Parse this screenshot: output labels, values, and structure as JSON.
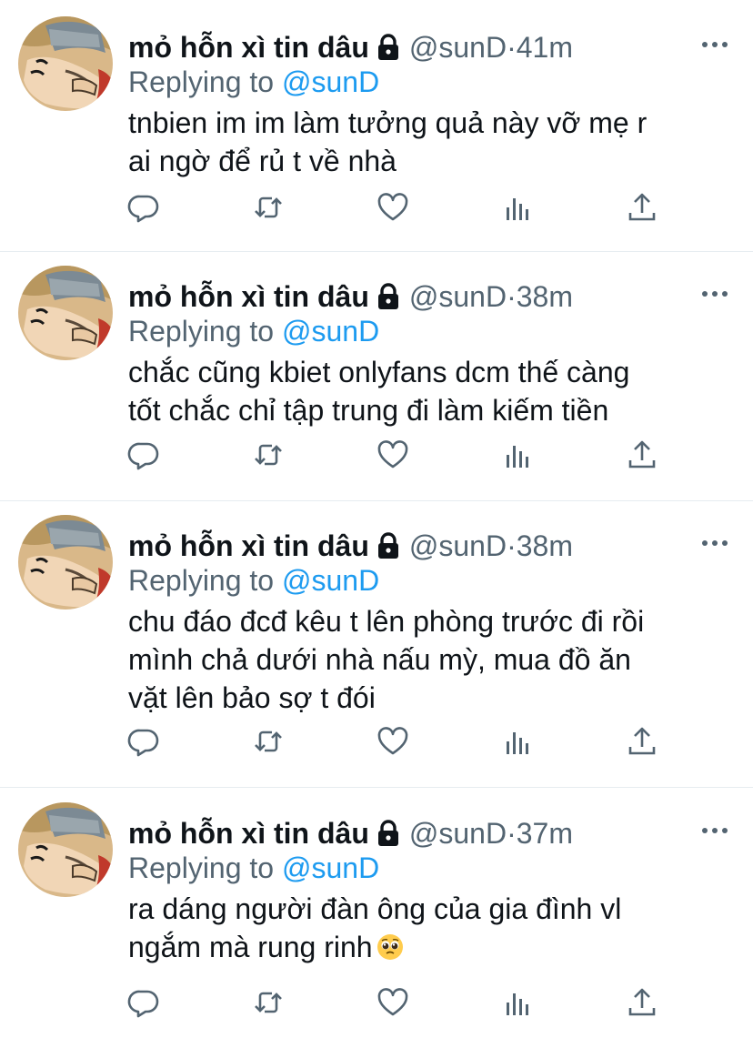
{
  "tweets": [
    {
      "name": "mỏ hỗn xì tin dâu",
      "handle": "@sunD",
      "separator": " · ",
      "time": "41m",
      "replying_label": "Replying to ",
      "replying_to": "@sunD",
      "text_lines": [
        "tnbien im im làm tưởng quả này vỡ mẹ r",
        "ai ngờ để rủ t về nhà"
      ]
    },
    {
      "name": "mỏ hỗn xì tin dâu",
      "handle": "@sunD",
      "separator": " · ",
      "time": "38m",
      "replying_label": "Replying to ",
      "replying_to": "@sunD",
      "text_lines": [
        "chắc cũng kbiet onlyfans dcm thế càng",
        "tốt chắc chỉ tập trung đi làm kiếm tiền"
      ]
    },
    {
      "name": "mỏ hỗn xì tin dâu",
      "handle": "@sunD",
      "separator": " · ",
      "time": "38m",
      "replying_label": "Replying to ",
      "replying_to": "@sunD",
      "text_lines": [
        "chu đáo đcđ kêu t lên phòng trước đi rồi",
        "mình chả dưới nhà nấu mỳ, mua đồ ăn",
        "vặt lên bảo sợ t đói"
      ]
    },
    {
      "name": "mỏ hỗn xì tin dâu",
      "handle": "@sunD",
      "separator": " · ",
      "time": "37m",
      "replying_label": "Replying to ",
      "replying_to": "@sunD",
      "text_lines": [
        "ra dáng người đàn ông của gia đình vl",
        "ngắm mà rung rinh"
      ]
    }
  ],
  "icons": {
    "lock": "lock-icon",
    "more": "more-dots-icon",
    "reply": "reply-icon",
    "retweet": "retweet-icon",
    "like": "heart-icon",
    "analytics": "analytics-icon",
    "share": "share-icon",
    "emoji": "pleading-face-emoji"
  },
  "colors": {
    "text": "#0f1419",
    "secondary": "#536471",
    "link": "#1d9bf0",
    "divider": "#e6ecf0"
  }
}
